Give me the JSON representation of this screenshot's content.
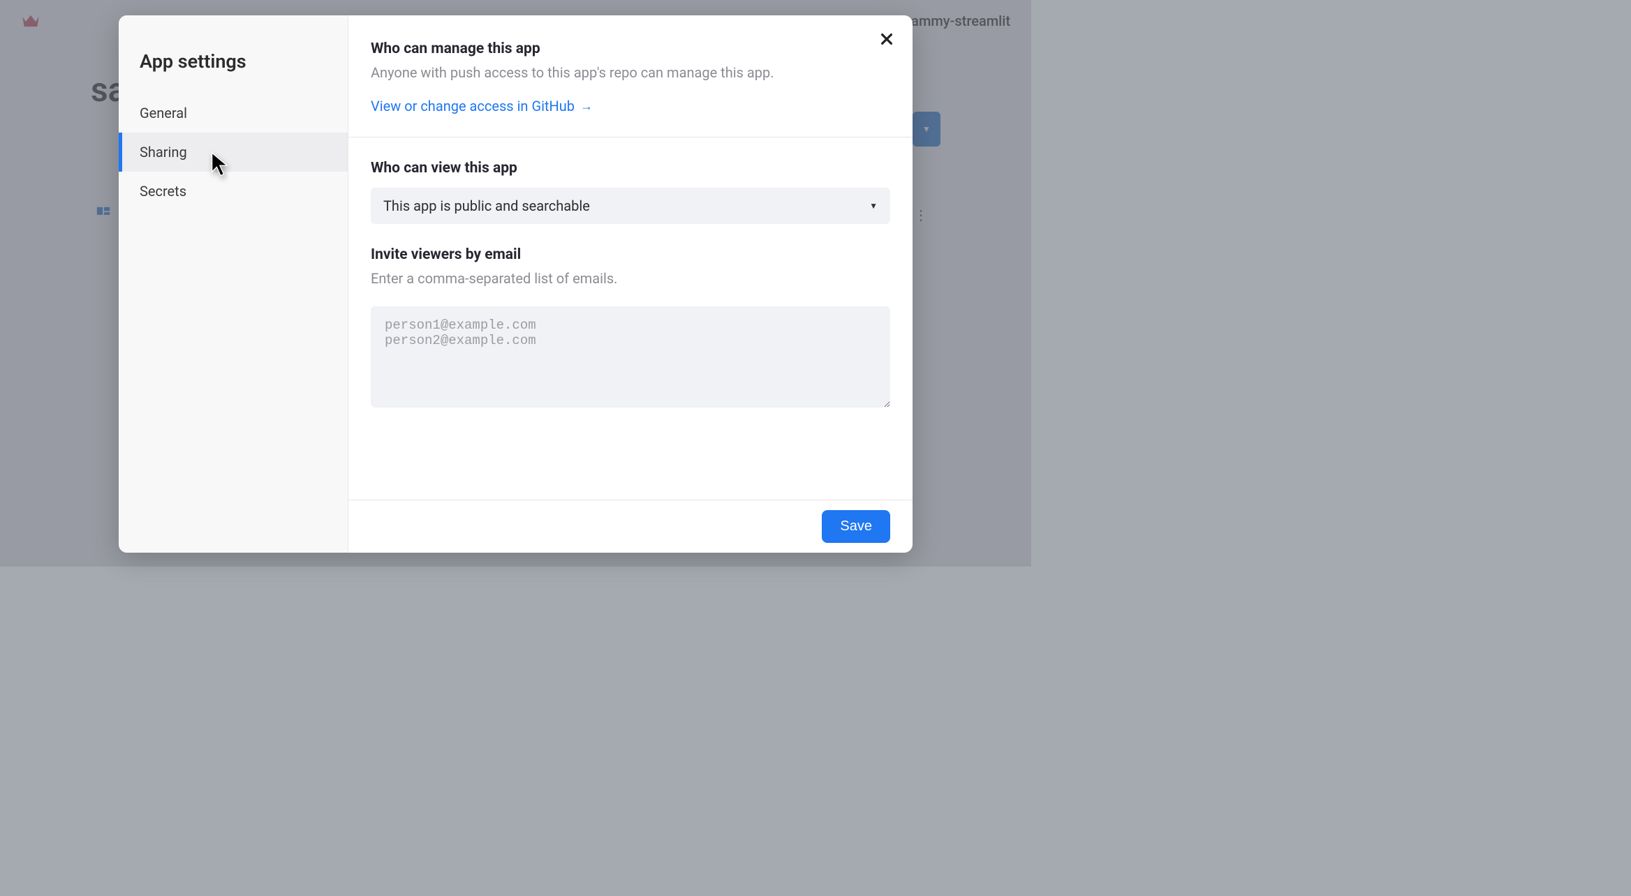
{
  "background": {
    "user_label": "ammy-streamlit",
    "title_fragment": "sa"
  },
  "modal": {
    "title": "App settings",
    "sidebar": {
      "items": [
        {
          "label": "General"
        },
        {
          "label": "Sharing"
        },
        {
          "label": "Secrets"
        }
      ]
    },
    "manage": {
      "heading": "Who can manage this app",
      "sub": "Anyone with push access to this app's repo can manage this app.",
      "link_text": "View or change access in GitHub"
    },
    "view": {
      "heading": "Who can view this app",
      "selected": "This app is public and searchable"
    },
    "invite": {
      "heading": "Invite viewers by email",
      "sub": "Enter a comma-separated list of emails.",
      "placeholder": "person1@example.com\nperson2@example.com"
    },
    "footer": {
      "save_label": "Save"
    }
  }
}
